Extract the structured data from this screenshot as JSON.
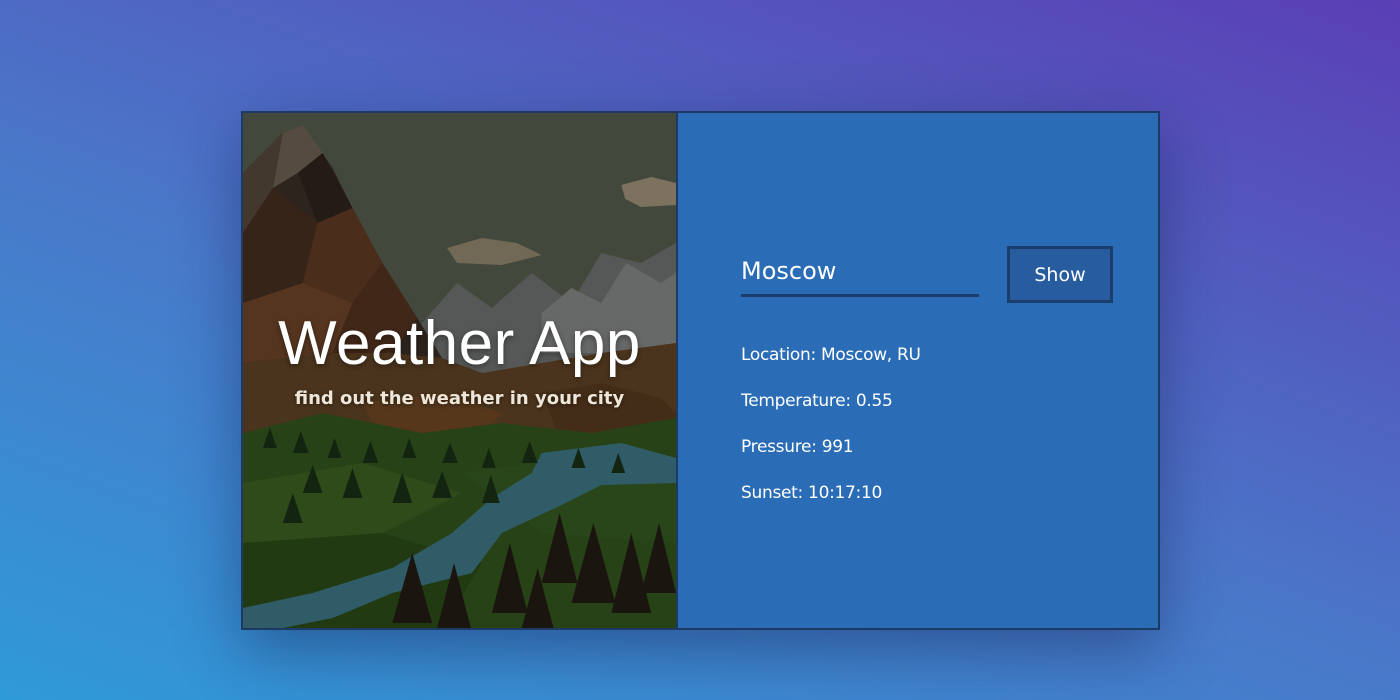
{
  "hero": {
    "title": "Weather App",
    "subtitle": "find out the weather in your city"
  },
  "form": {
    "city_value": "Moscow",
    "button_label": "Show"
  },
  "weather": {
    "location": "Location: Moscow, RU",
    "temperature": "Temperature: 0.55",
    "pressure": "Pressure: 991",
    "sunset": "Sunset: 10:17:10"
  },
  "colors": {
    "panel": "#2b6cb7",
    "border": "#1d3a66",
    "button": "#275c9e"
  }
}
